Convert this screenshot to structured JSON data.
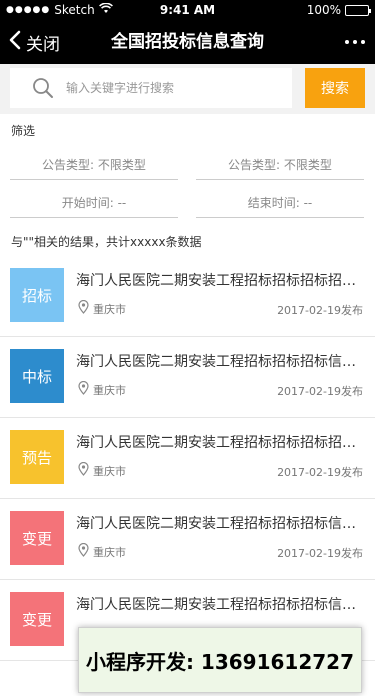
{
  "status_bar": {
    "carrier": "Sketch",
    "time": "9:41 AM",
    "battery": "100%"
  },
  "nav": {
    "back_label": "关闭",
    "title": "全国招投标信息查询"
  },
  "search": {
    "placeholder": "输入关键字进行搜索",
    "value": "",
    "button_label": "搜索"
  },
  "filter": {
    "title": "筛选",
    "fields": [
      {
        "label": "公告类型:",
        "value": "不限类型"
      },
      {
        "label": "公告类型:",
        "value": "不限类型"
      },
      {
        "label": "开始时间:",
        "value": "--"
      },
      {
        "label": "结束时间:",
        "value": "--"
      }
    ]
  },
  "result_summary": "与\"\"相关的结果，共计xxxxx条数据",
  "items": [
    {
      "badge": "招标",
      "badge_color": "#7ac4f3",
      "title": "海门人民医院二期安装工程招标招标招标招标...",
      "location": "重庆市",
      "date": "2017-02-19发布"
    },
    {
      "badge": "中标",
      "badge_color": "#2d8ccd",
      "title": "海门人民医院二期安装工程招标招标招标信息...",
      "location": "重庆市",
      "date": "2017-02-19发布"
    },
    {
      "badge": "预告",
      "badge_color": "#f7c22d",
      "title": "海门人民医院二期安装工程招标招标招标招标...",
      "location": "重庆市",
      "date": "2017-02-19发布"
    },
    {
      "badge": "变更",
      "badge_color": "#f47379",
      "title": "海门人民医院二期安装工程招标招标招标信息...",
      "location": "重庆市",
      "date": "2017-02-19发布"
    },
    {
      "badge": "变更",
      "badge_color": "#f47379",
      "title": "海门人民医院二期安装工程招标招标招标信息...",
      "location": "",
      "date": ""
    }
  ],
  "ad_text": "小程序开发:  13691612727",
  "icons": {
    "back": "chevron-left-icon",
    "more": "more-dots-icon",
    "search": "search-icon",
    "location": "location-pin-icon",
    "wifi": "wifi-icon",
    "battery": "battery-icon"
  },
  "colors": {
    "header_bg": "#000000",
    "search_button": "#f8a20f"
  }
}
